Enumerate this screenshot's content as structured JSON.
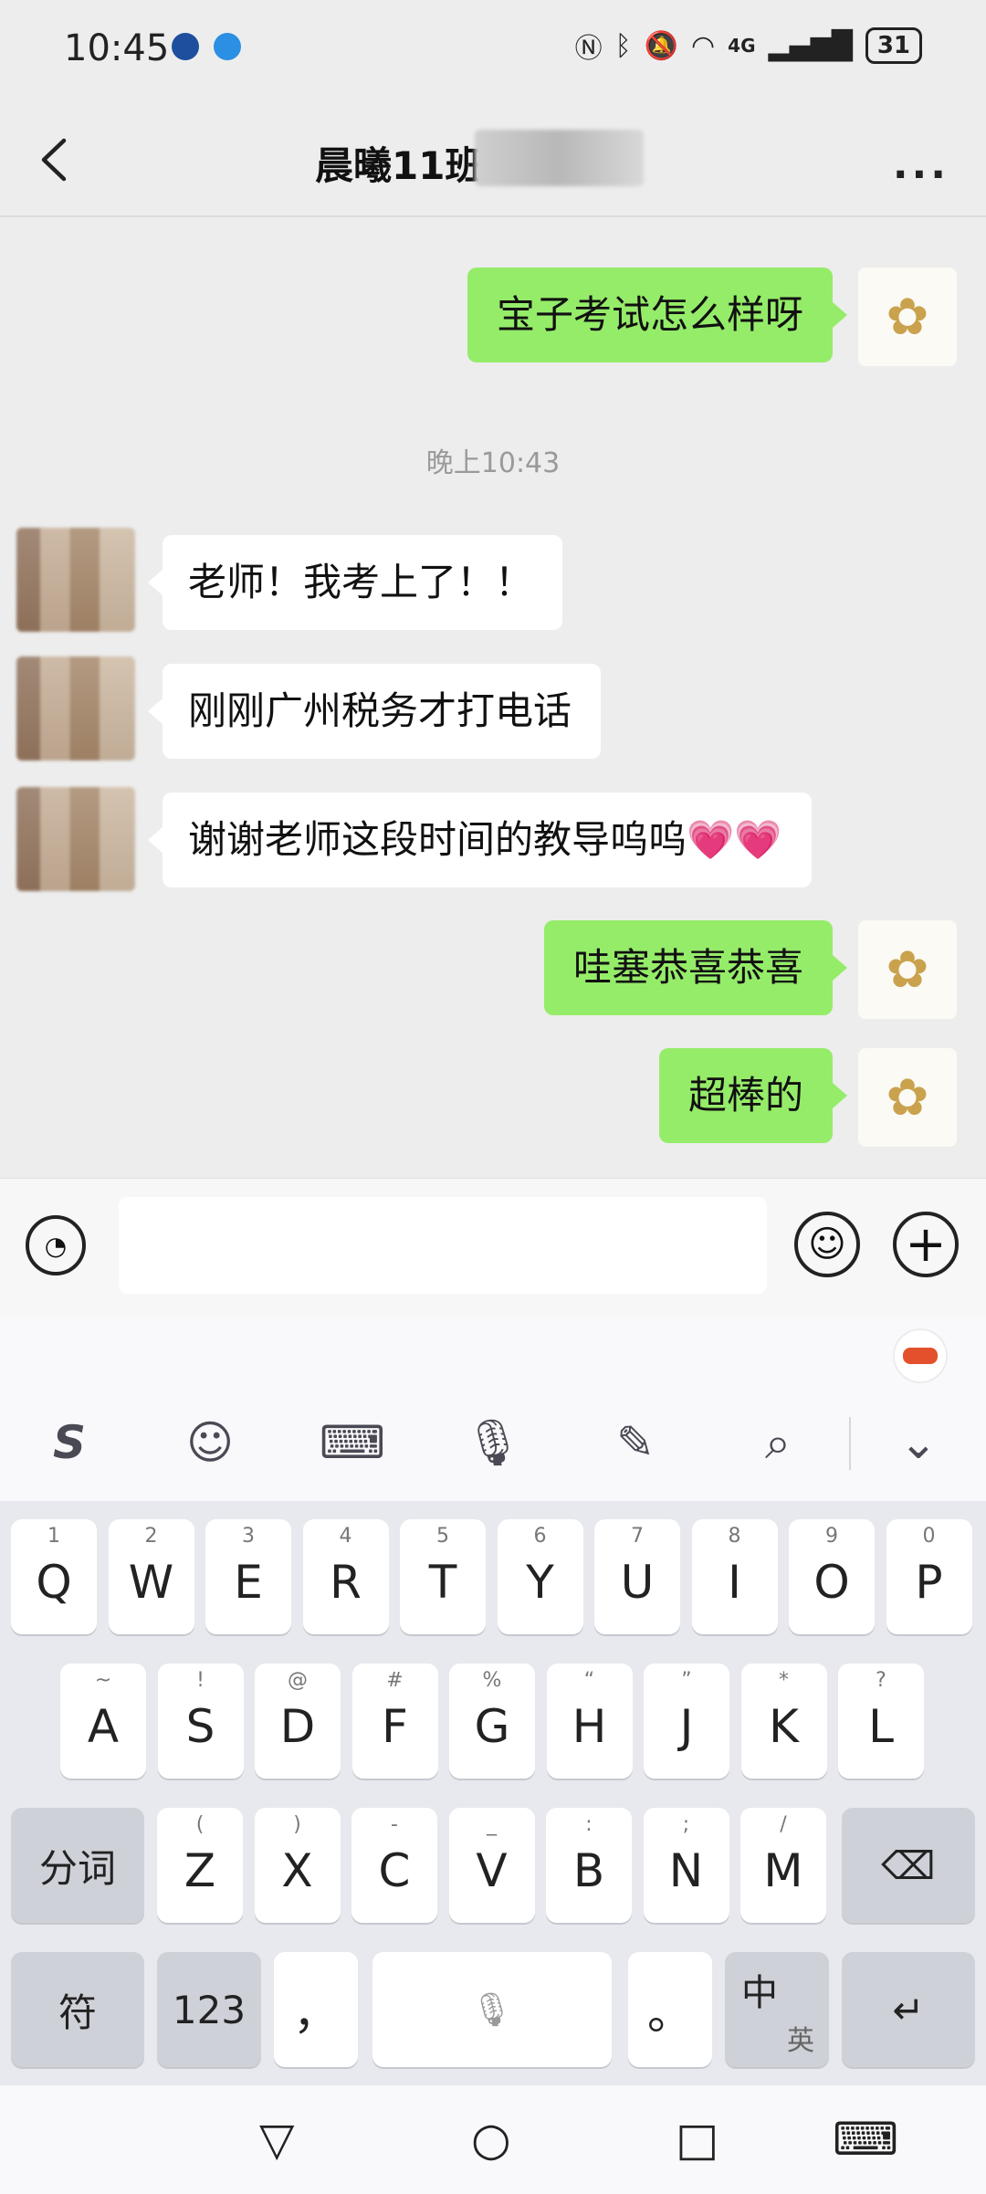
{
  "status": {
    "time": "10:45",
    "network": "4G",
    "battery": "31"
  },
  "header": {
    "title": "晨曦11班"
  },
  "chat": {
    "timestamp": "晚上10:43",
    "messages": [
      {
        "from": "me",
        "text": "宝子考试怎么样呀"
      },
      {
        "from": "other",
        "text": "老师！我考上了！！"
      },
      {
        "from": "other",
        "text": "刚刚广州税务才打电话"
      },
      {
        "from": "other",
        "text": "谢谢老师这段时间的教导呜呜💗💗"
      },
      {
        "from": "me",
        "text": "哇塞恭喜恭喜"
      },
      {
        "from": "me",
        "text": "超棒的"
      }
    ]
  },
  "input": {
    "placeholder": ""
  },
  "keyboard": {
    "toolbar": [
      "sogou-logo",
      "emoji",
      "keyboard",
      "microphone",
      "handwriting",
      "search",
      "collapse"
    ],
    "row1": [
      {
        "k": "Q",
        "h": "1"
      },
      {
        "k": "W",
        "h": "2"
      },
      {
        "k": "E",
        "h": "3"
      },
      {
        "k": "R",
        "h": "4"
      },
      {
        "k": "T",
        "h": "5"
      },
      {
        "k": "Y",
        "h": "6"
      },
      {
        "k": "U",
        "h": "7"
      },
      {
        "k": "I",
        "h": "8"
      },
      {
        "k": "O",
        "h": "9"
      },
      {
        "k": "P",
        "h": "0"
      }
    ],
    "row2": [
      {
        "k": "A",
        "h": "~"
      },
      {
        "k": "S",
        "h": "!"
      },
      {
        "k": "D",
        "h": "@"
      },
      {
        "k": "F",
        "h": "#"
      },
      {
        "k": "G",
        "h": "%"
      },
      {
        "k": "H",
        "h": "“"
      },
      {
        "k": "J",
        "h": "”"
      },
      {
        "k": "K",
        "h": "*"
      },
      {
        "k": "L",
        "h": "?"
      }
    ],
    "row3": [
      {
        "k": "Z",
        "h": "("
      },
      {
        "k": "X",
        "h": ")"
      },
      {
        "k": "C",
        "h": "-"
      },
      {
        "k": "V",
        "h": "_"
      },
      {
        "k": "B",
        "h": ":"
      },
      {
        "k": "N",
        "h": ";"
      },
      {
        "k": "M",
        "h": "/"
      }
    ],
    "segment_key": "分词",
    "symbol_key": "符",
    "number_key": "123",
    "comma_key": "，",
    "period_key": "。",
    "lang_key_main": "中",
    "lang_key_sub": "英"
  }
}
